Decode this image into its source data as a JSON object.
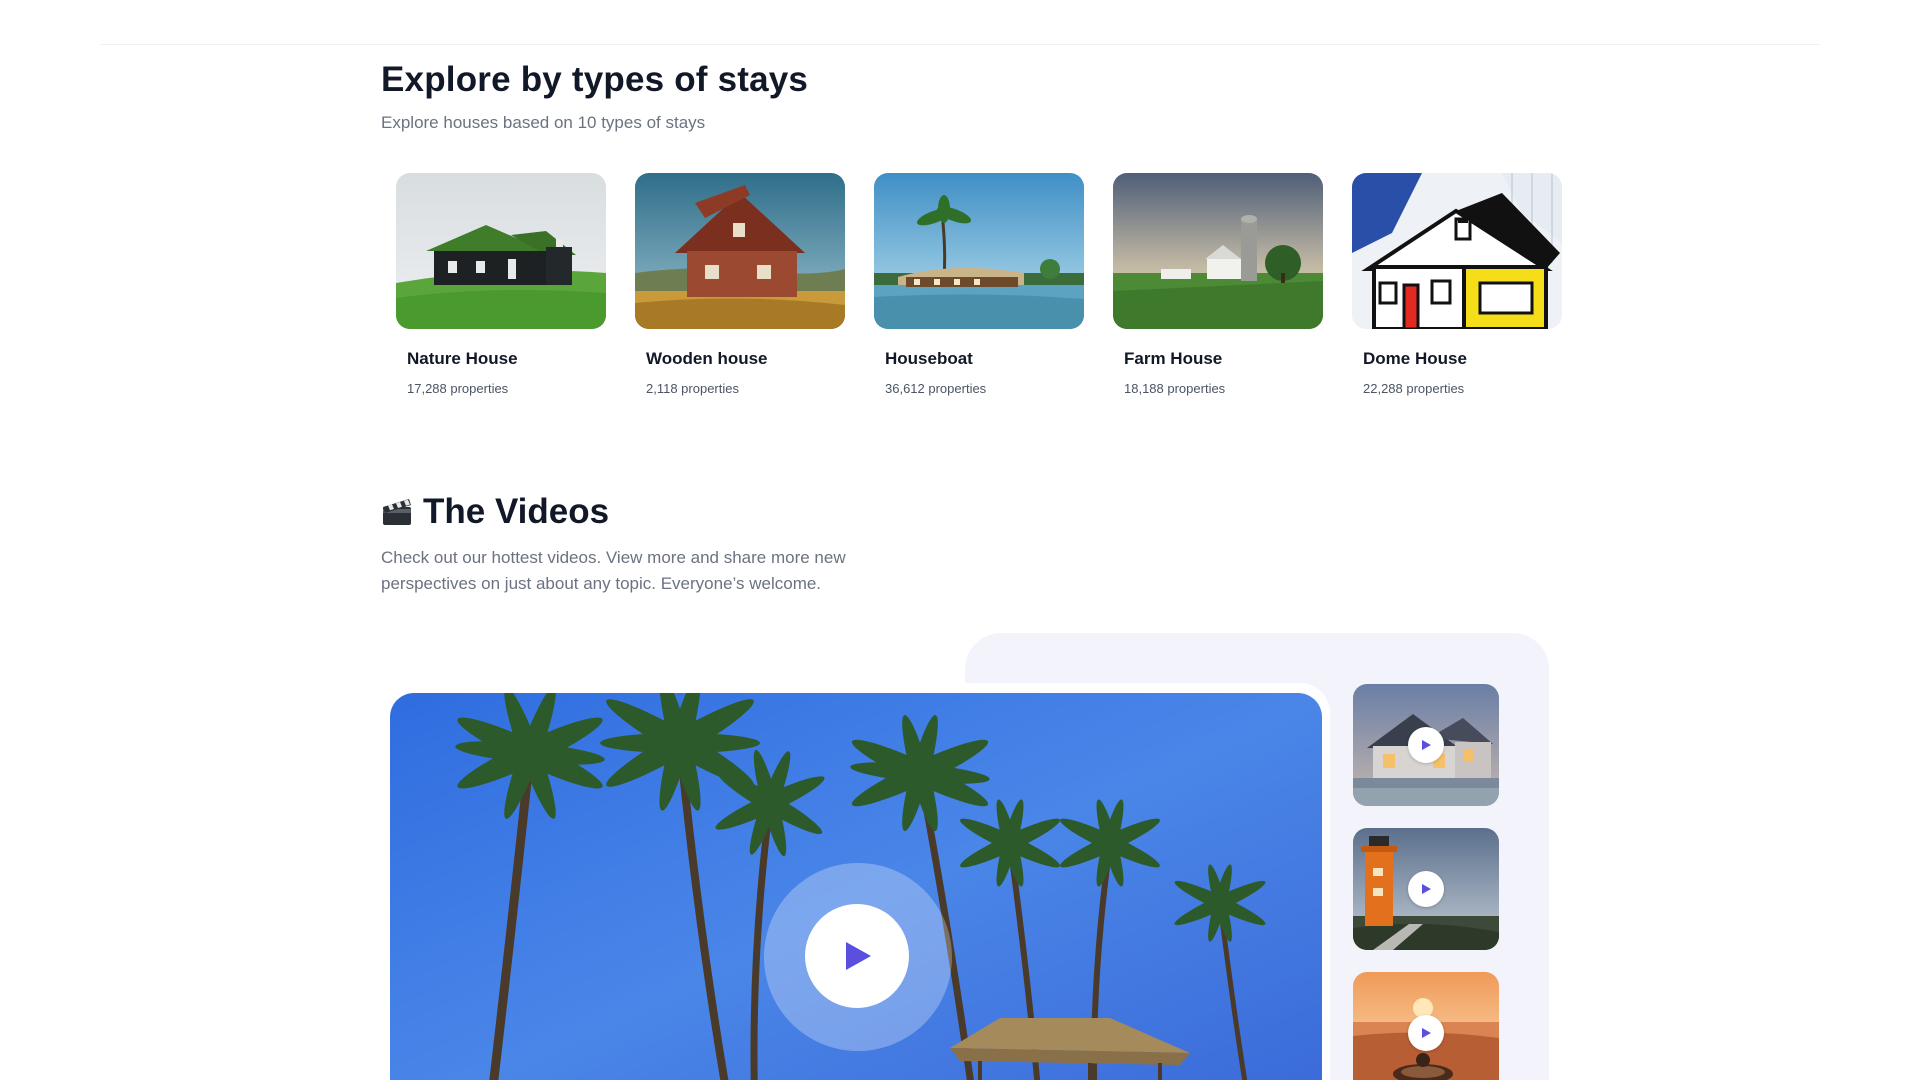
{
  "stays": {
    "title": "Explore by types of stays",
    "subtitle": "Explore houses based on 10 types of stays",
    "items": [
      {
        "name": "Nature House",
        "count": "17,288 properties"
      },
      {
        "name": "Wooden house",
        "count": "2,118 properties"
      },
      {
        "name": "Houseboat",
        "count": "36,612 properties"
      },
      {
        "name": "Farm House",
        "count": "18,188 properties"
      },
      {
        "name": "Dome House",
        "count": "22,288 properties"
      }
    ]
  },
  "videos": {
    "icon": "clapperboard-icon",
    "title": "The Videos",
    "subtitle_line1": "Check out our hottest videos. View more and share more new",
    "subtitle_line2": "perspectives on just about any topic. Everyone’s welcome.",
    "thumbnails": [
      "house-dusk-thumbnail",
      "lighthouse-thumbnail",
      "sunset-sea-thumbnail"
    ]
  },
  "colors": {
    "accent": "#5b4fe0",
    "panel": "#f3f4fb",
    "title": "#111827",
    "muted": "#6b7280"
  }
}
